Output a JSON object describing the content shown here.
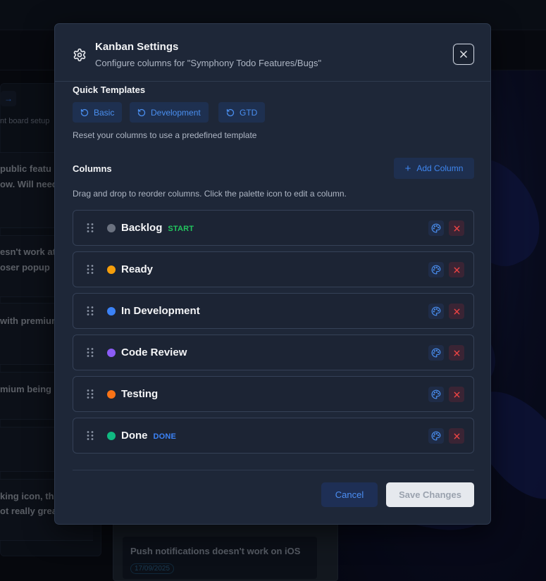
{
  "background": {
    "left_panel_text": "nt board setup",
    "card_snippets": [
      "public featu",
      "ow. Will need",
      "esn't work at",
      "oser popup",
      "with premium",
      "mium being",
      "king icon, th",
      "ot really grea"
    ],
    "push_card": {
      "title": "Push notifications doesn't work on iOS",
      "date": "17/09/2025"
    }
  },
  "modal": {
    "title": "Kanban Settings",
    "subtitle": "Configure columns for \"Symphony Todo Features/Bugs\"",
    "icons": {
      "settings": "gear-icon",
      "close": "close-icon"
    },
    "quick_templates": {
      "label": "Quick Templates",
      "buttons": [
        {
          "label": "Basic",
          "icon": "reset-icon"
        },
        {
          "label": "Development",
          "icon": "reset-icon"
        },
        {
          "label": "GTD",
          "icon": "reset-icon"
        }
      ],
      "help": "Reset your columns to use a predefined template"
    },
    "columns_section": {
      "label": "Columns",
      "add_button": "Add Column",
      "help": "Drag and drop to reorder columns. Click the palette icon to edit a column.",
      "items": [
        {
          "name": "Backlog",
          "color": "#6b7280",
          "tag": "START",
          "tag_color": "#22c55e"
        },
        {
          "name": "Ready",
          "color": "#f59e0b",
          "tag": "",
          "tag_color": ""
        },
        {
          "name": "In Development",
          "color": "#3b82f6",
          "tag": "",
          "tag_color": ""
        },
        {
          "name": "Code Review",
          "color": "#8b5cf6",
          "tag": "",
          "tag_color": ""
        },
        {
          "name": "Testing",
          "color": "#f97316",
          "tag": "",
          "tag_color": ""
        },
        {
          "name": "Done",
          "color": "#10b981",
          "tag": "DONE",
          "tag_color": "#3b82f6"
        }
      ]
    },
    "footer": {
      "cancel": "Cancel",
      "save": "Save Changes"
    }
  }
}
